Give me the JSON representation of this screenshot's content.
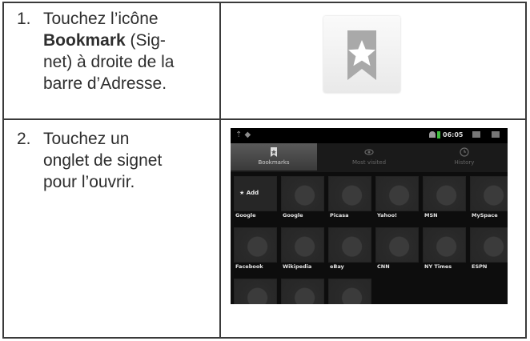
{
  "steps": [
    {
      "number": "1.",
      "line1": "Touchez l’icône",
      "line2_bold": "Bookmark",
      "line2_rest": " (Sig-",
      "line3": "net) à droite de la",
      "line4": "barre d’Adresse."
    },
    {
      "number": "2.",
      "line1": "Touchez un",
      "line2": "onglet de signet",
      "line3": "pour l’ouvrir."
    }
  ],
  "bookmark_icon": {
    "icon": "bookmark-star-icon",
    "color": "#a9a9a9"
  },
  "screenshot": {
    "status_time": "06:05",
    "tabs": [
      {
        "label": "Bookmarks",
        "icon": "bookmark-icon",
        "active": true
      },
      {
        "label": "Most visited",
        "icon": "eye-icon",
        "active": false
      },
      {
        "label": "History",
        "icon": "clock-icon",
        "active": false
      }
    ],
    "add_label": "Add",
    "bookmarks": [
      "Google",
      "Google",
      "Picasa",
      "Yahoo!",
      "MSN",
      "MySpace",
      "Facebook",
      "Wikipedia",
      "eBay",
      "CNN",
      "NY Times",
      "ESPN"
    ]
  }
}
